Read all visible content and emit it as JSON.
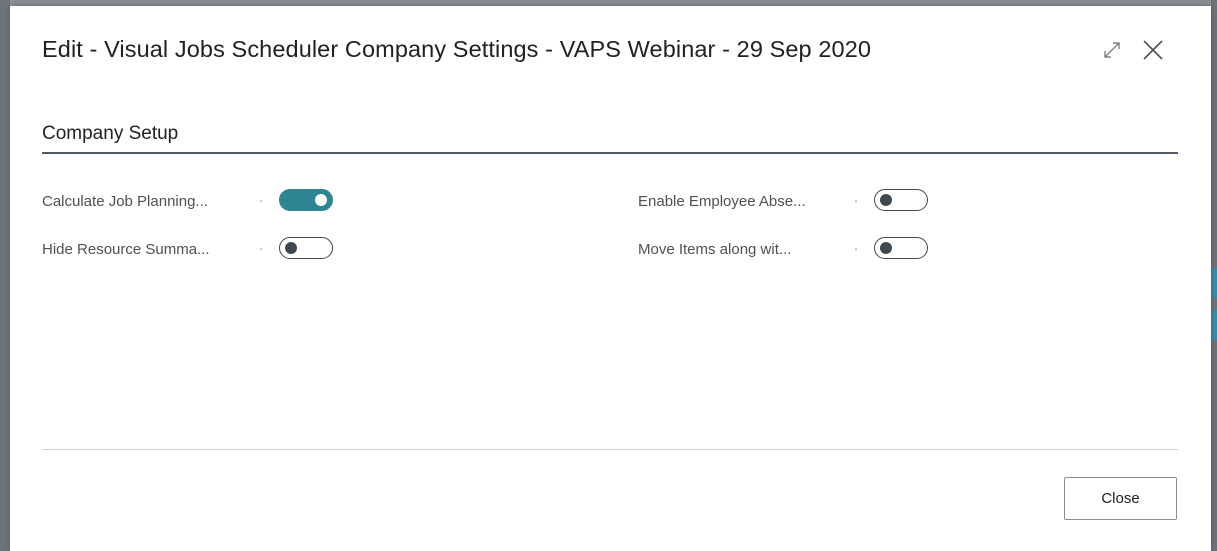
{
  "dialog": {
    "title": "Edit - Visual Jobs Scheduler Company Settings - VAPS Webinar - 29 Sep 2020",
    "expand_icon": "expand-icon",
    "close_icon": "close-icon"
  },
  "section": {
    "title": "Company Setup"
  },
  "fields": [
    {
      "label": "Calculate Job Planning...",
      "enabled": true
    },
    {
      "label": "Hide Resource Summa...",
      "enabled": false
    },
    {
      "label": "Enable Employee Abse...",
      "enabled": false
    },
    {
      "label": "Move Items along wit...",
      "enabled": false
    }
  ],
  "footer": {
    "close_label": "Close"
  },
  "colors": {
    "toggle_on": "#2e8491",
    "toggle_off_knob": "#404854",
    "section_rule": "#505863"
  }
}
